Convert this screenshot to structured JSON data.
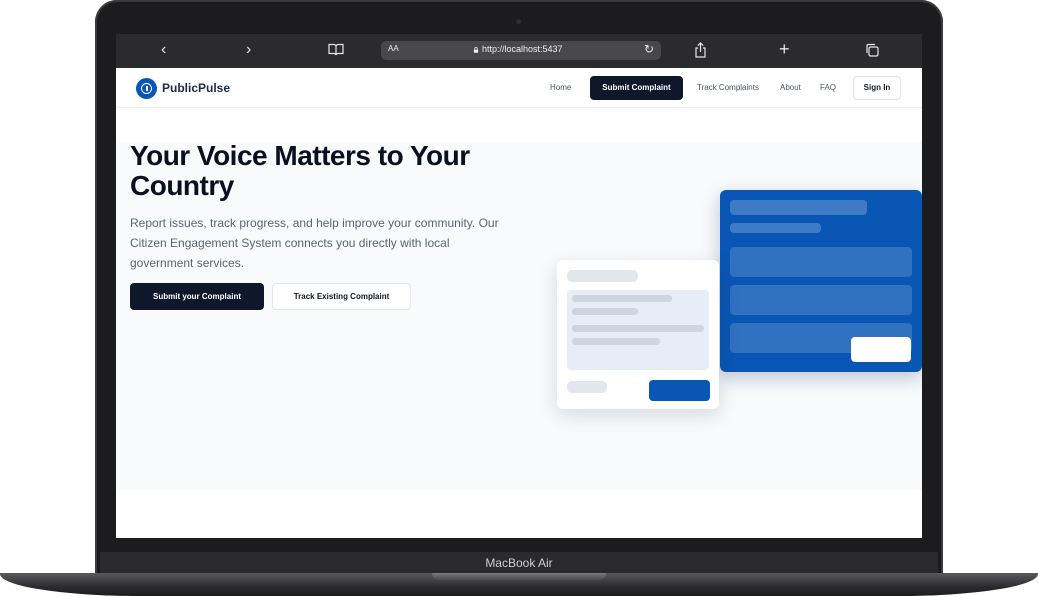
{
  "device": {
    "label": "MacBook Air"
  },
  "browser": {
    "text_size_label": "AA",
    "url": "http://localhost:5437",
    "icons": {
      "back": "chevron-left-icon",
      "forward": "chevron-right-icon",
      "bookmarks": "book-icon",
      "reload": "reload-icon",
      "share": "share-icon",
      "new_tab": "plus-icon",
      "tabs": "tabs-icon",
      "lock": "lock-icon"
    }
  },
  "site": {
    "brand": "PublicPulse",
    "accent_color": "#0a56b5",
    "nav": {
      "home": "Home",
      "submit": "Submit Complaint",
      "track": "Track Complaints",
      "about": "About",
      "faq": "FAQ",
      "signin": "Sign In"
    },
    "hero": {
      "title": "Your Voice Matters to Your Country",
      "description": "Report issues, track progress, and help improve your community. Our Citizen Engagement System connects you directly with local government services.",
      "primary_cta": "Submit your Complaint",
      "secondary_cta": "Track Existing Complaint"
    }
  }
}
